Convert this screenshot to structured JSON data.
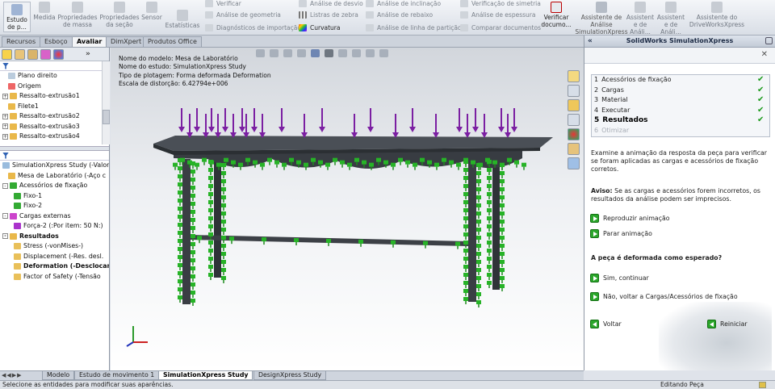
{
  "ribbon": {
    "large_buttons": [
      {
        "label": "Estudo de p...",
        "icon": "study-icon"
      },
      {
        "label": "Medida",
        "icon": "measure-icon"
      },
      {
        "label": "Propriedades de massa",
        "icon": "mass-properties-icon"
      },
      {
        "label": "Propriedades da seção",
        "icon": "section-properties-icon"
      },
      {
        "label": "Sensor",
        "icon": "sensor-icon"
      },
      {
        "label": "Estatísticas",
        "icon": "statistics-icon"
      }
    ],
    "col1": [
      "Verificar",
      "Análise de geometria",
      "Diagnósticos de importação"
    ],
    "col2": [
      "Análise de desvio",
      "Listras de zebra",
      "Curvatura"
    ],
    "col3": [
      "Análise de inclinação",
      "Análise de rebaixo",
      "Análise de linha de partição"
    ],
    "col4": [
      "Verificação de simetria",
      "Análise de espessura",
      "Comparar documentos"
    ],
    "verify_button": "Verificar documo...",
    "assistants": [
      "Assistente de Análise SimulationXpress",
      "Assistent e de Análi...",
      "Assistent e de Análi...",
      "Assistente do DriveWorksXpress"
    ]
  },
  "tabs": [
    "Recursos",
    "Esboço",
    "Avaliar",
    "DimXpert",
    "Produtos Office"
  ],
  "active_tab": "Avaliar",
  "feature_tree": [
    {
      "label": "Plano direito",
      "indent": 1,
      "icon": "plane-icon"
    },
    {
      "label": "Origem",
      "indent": 1,
      "icon": "origin-icon"
    },
    {
      "label": "Ressalto-extrusão1",
      "indent": 0,
      "icon": "extrude-icon",
      "expand": "+"
    },
    {
      "label": "Filete1",
      "indent": 1,
      "icon": "fillet-icon"
    },
    {
      "label": "Ressalto-extrusão2",
      "indent": 0,
      "icon": "extrude-icon",
      "expand": "+"
    },
    {
      "label": "Ressalto-extrusão3",
      "indent": 0,
      "icon": "extrude-icon",
      "expand": "+"
    },
    {
      "label": "Ressalto-extrusão4",
      "indent": 0,
      "icon": "extrude-icon",
      "expand": "+"
    }
  ],
  "sim_tree": [
    {
      "label": "SimulationXpress Study (-Valor p",
      "indent": 0,
      "icon": "study-icon",
      "bold": false
    },
    {
      "label": "Mesa de Laboratório (-Aço c",
      "indent": 1,
      "icon": "part-icon",
      "bold": false
    },
    {
      "label": "Acessórios de fixação",
      "indent": 0,
      "icon": "fixture-icon",
      "bold": false,
      "expand": "-"
    },
    {
      "label": "Fixo-1",
      "indent": 2,
      "icon": "fixed-icon",
      "bold": false
    },
    {
      "label": "Fixo-2",
      "indent": 2,
      "icon": "fixed-icon",
      "bold": false
    },
    {
      "label": "Cargas externas",
      "indent": 0,
      "icon": "loads-icon",
      "bold": false,
      "expand": "-"
    },
    {
      "label": "Força-2 (:Por item: 50 N:)",
      "indent": 2,
      "icon": "force-icon",
      "bold": false
    },
    {
      "label": "Resultados",
      "indent": 0,
      "icon": "results-icon",
      "bold": true,
      "expand": "-"
    },
    {
      "label": "Stress (-vonMises-)",
      "indent": 2,
      "icon": "plot-icon",
      "bold": false
    },
    {
      "label": "Displacement (-Res. desl.",
      "indent": 2,
      "icon": "plot-icon",
      "bold": false
    },
    {
      "label": "Deformation (-Desclocan",
      "indent": 2,
      "icon": "plot-icon",
      "bold": true
    },
    {
      "label": "Factor of Safety (-Tensão",
      "indent": 2,
      "icon": "plot-icon",
      "bold": false
    }
  ],
  "viewport_info": [
    "Nome do modelo: Mesa de Laboratório",
    "Nome do estudo: SimulationXpress Study",
    "Tipo de plotagem: Forma deformada Deformation",
    "Escala de distorção: 6.42794e+006"
  ],
  "panel": {
    "title": "SolidWorks SimulationXpress",
    "steps": [
      {
        "num": "1",
        "label": "Acessórios de fixação",
        "state": "done"
      },
      {
        "num": "2",
        "label": "Cargas",
        "state": "done"
      },
      {
        "num": "3",
        "label": "Material",
        "state": "done"
      },
      {
        "num": "4",
        "label": "Executar",
        "state": "done"
      },
      {
        "num": "5",
        "label": "Resultados",
        "state": "current"
      },
      {
        "num": "6",
        "label": "Otimizar",
        "state": "disabled"
      }
    ],
    "desc": "Examine a animação da resposta da peça para verificar se foram aplicadas as cargas e acessórios de fixação corretos.",
    "warning_label": "Aviso:",
    "warning": "Se as cargas e acessórios forem incorretos, os resultados da análise podem ser imprecisos.",
    "play": "Reproduzir animação",
    "stop": "Parar animação",
    "question": "A peça é deformada como esperado?",
    "yes": "Sim, continuar",
    "no": "Não, voltar a Cargas/Acessórios de fixação",
    "back": "Voltar",
    "restart": "Reiniciar"
  },
  "bottom_tabs": [
    "Modelo",
    "Estudo de movimento 1",
    "SimulationXpress Study",
    "DesignXpress Study"
  ],
  "active_bottom_tab": "SimulationXpress Study",
  "status": {
    "left": "Selecione as entidades para modificar suas aparências.",
    "right": "Editando Peça"
  },
  "colors": {
    "load_arrow": "#7b1fa2",
    "fixture": "#27b327",
    "model": "#3b3f44",
    "accent": "#1c2a44"
  }
}
